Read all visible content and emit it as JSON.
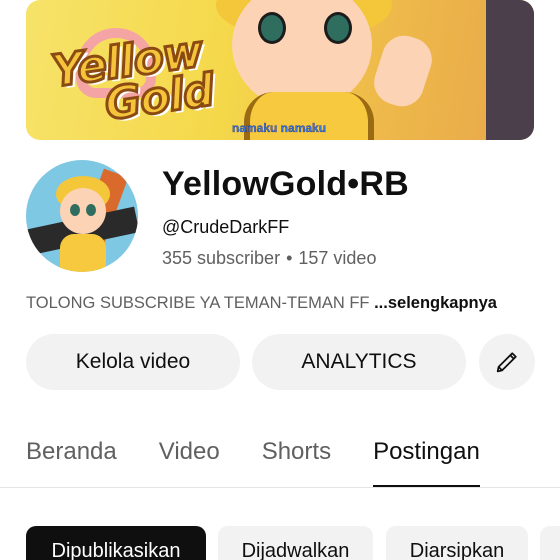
{
  "banner": {
    "logo_line1": "Yellow",
    "logo_line2": "Gold",
    "caption": "namaku namaku"
  },
  "channel": {
    "name": "YellowGold•RB",
    "handle": "@CrudeDarkFF",
    "subscribers": "355 subscriber",
    "separator": "•",
    "videos": "157 video",
    "description": "TOLONG SUBSCRIBE YA TEMAN-TEMAN FF",
    "more_link": " ...selengkapnya"
  },
  "actions": {
    "manage_label": "Kelola video",
    "analytics_label": "ANALYTICS",
    "edit_icon": "pencil-icon"
  },
  "tabs": [
    {
      "label": "Beranda",
      "active": false
    },
    {
      "label": "Video",
      "active": false
    },
    {
      "label": "Shorts",
      "active": false
    },
    {
      "label": "Postingan",
      "active": true
    }
  ],
  "chips": [
    {
      "label": "Dipublikasikan",
      "active": true
    },
    {
      "label": "Dijadwalkan",
      "active": false
    },
    {
      "label": "Diarsipkan",
      "active": false
    }
  ],
  "colors": {
    "text_primary": "#0f0f0f",
    "text_secondary": "#606060",
    "button_bg": "#f2f2f2",
    "chip_active_bg": "#0f0f0f"
  }
}
